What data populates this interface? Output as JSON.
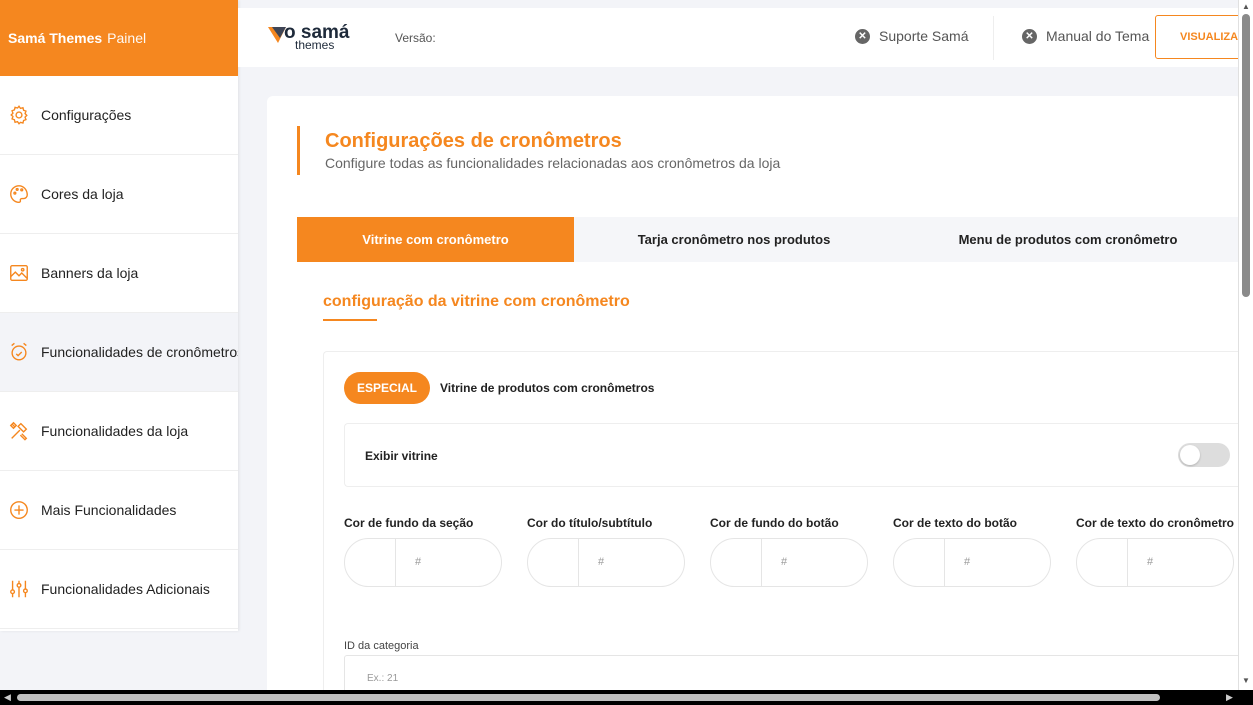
{
  "brand": {
    "name": "Samá Themes",
    "suffix": "Painel"
  },
  "sidebar": {
    "items": [
      {
        "label": "Configurações",
        "icon": "gear-icon"
      },
      {
        "label": "Cores da loja",
        "icon": "palette-icon"
      },
      {
        "label": "Banners da loja",
        "icon": "image-icon"
      },
      {
        "label": "Funcionalidades de cronômetros",
        "icon": "alarm-clock-icon",
        "active": true
      },
      {
        "label": "Funcionalidades da loja",
        "icon": "tools-icon"
      },
      {
        "label": "Mais Funcionalidades",
        "icon": "plus-circle-icon"
      },
      {
        "label": "Funcionalidades Adicionais",
        "icon": "sliders-icon"
      }
    ]
  },
  "topbar": {
    "logo_top": "o samá",
    "logo_bottom": "themes",
    "version_label": "Versão:",
    "support_label": "Suporte Samá",
    "manual_label": "Manual do Tema",
    "visualize_label": "VISUALIZAR"
  },
  "main": {
    "title": "Configurações de cronômetros",
    "subtitle": "Configure todas as funcionalidades relacionadas aos cronômetros da loja",
    "tabs": [
      {
        "label": "Vitrine com cronômetro",
        "active": true
      },
      {
        "label": "Tarja cronômetro nos produtos"
      },
      {
        "label": "Menu de produtos com cronômetro"
      }
    ],
    "section_title": "configuração da vitrine com cronômetro",
    "badge": "ESPECIAL",
    "badge_label": "Vitrine de produtos com cronômetros",
    "toggle_label": "Exibir vitrine",
    "toggle_on": false,
    "color_fields": [
      {
        "label": "Cor de fundo da seção",
        "placeholder": "#"
      },
      {
        "label": "Cor do título/subtítulo",
        "placeholder": "#"
      },
      {
        "label": "Cor de fundo do botão",
        "placeholder": "#"
      },
      {
        "label": "Cor de texto do botão",
        "placeholder": "#"
      },
      {
        "label": "Cor de texto do cronômetro",
        "placeholder": "#"
      }
    ],
    "category_label": "ID da categoria",
    "category_placeholder": "Ex.: 21"
  },
  "colors": {
    "accent": "#f5871f",
    "background": "#f3f4f8"
  }
}
